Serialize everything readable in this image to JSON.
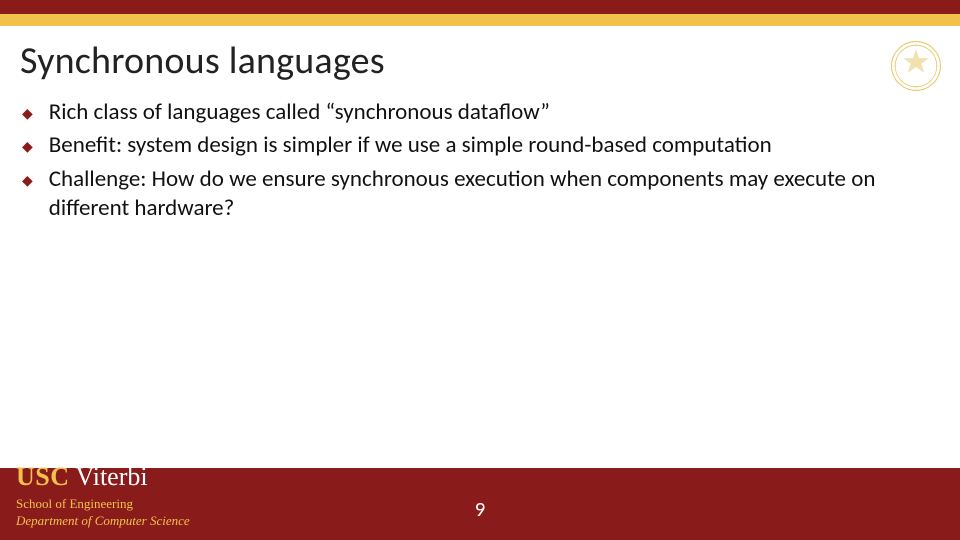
{
  "title": "Synchronous languages",
  "bullets": [
    "Rich class of languages called “synchronous dataflow”",
    "Benefit: system design is simpler if we use a simple round-based computation",
    "Challenge: How do we ensure synchronous execution when components may execute on different hardware?"
  ],
  "footer": {
    "brand_usc": "USC",
    "brand_viterbi": "Viterbi",
    "line1": "School of Engineering",
    "line2": "Department of Computer Science"
  },
  "page_number": "9",
  "colors": {
    "cardinal": "#8a1b1b",
    "gold": "#f1c24b"
  }
}
